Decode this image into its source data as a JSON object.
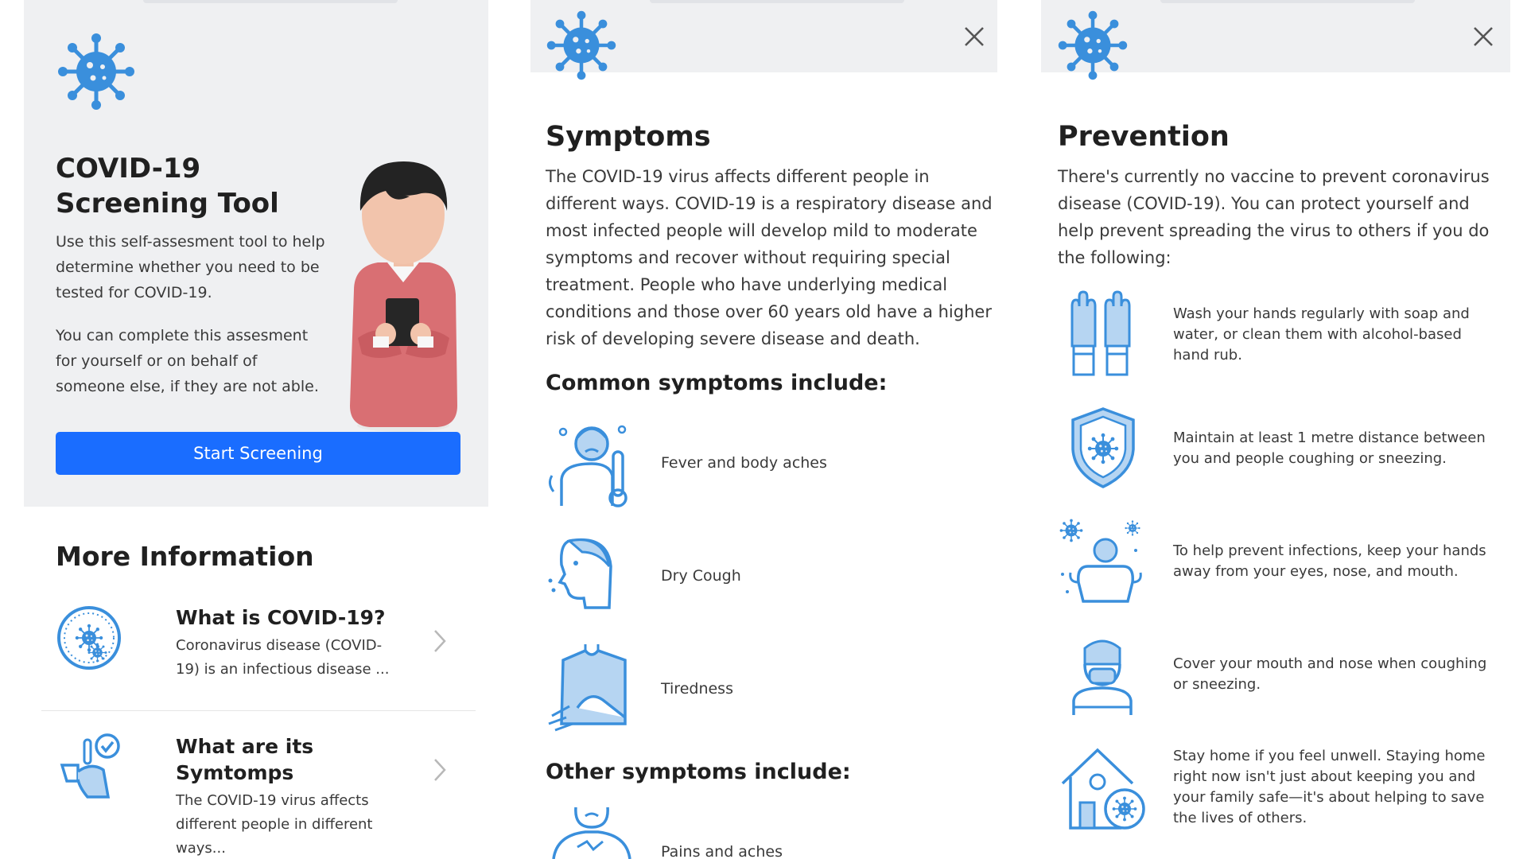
{
  "screening": {
    "title_line1": "COVID-19",
    "title_line2": "Screening Tool",
    "paragraph1": "Use this self-assesment tool to help determine whether you need to be tested for COVID-19.",
    "paragraph2": "You can complete this assesment for yourself or on behalf of someone else, if they are not able.",
    "button_label": "Start Screening"
  },
  "more_info": {
    "heading": "More Information",
    "items": [
      {
        "title": "What is COVID-19?",
        "desc": "Coronavirus disease (COVID-19) is an infectious disease ...",
        "icon": "virus-circle-icon"
      },
      {
        "title": "What are its Symtomps",
        "desc": "The COVID-19 virus affects different people in different ways...",
        "icon": "symptoms-check-icon"
      }
    ]
  },
  "symptoms": {
    "heading": "Symptoms",
    "intro": "The COVID-19 virus affects different people in different ways. COVID-19 is a respiratory disease and most infected people will develop mild to moderate symptoms and recover without requiring special treatment. People who have underlying medical conditions and those over 60 years old have a higher risk of developing severe disease and death.",
    "common_heading": "Common symptoms include:",
    "common": [
      {
        "label": "Fever and body aches",
        "icon": "fever-thermometer-icon"
      },
      {
        "label": "Dry Cough",
        "icon": "cough-face-icon"
      },
      {
        "label": "Tiredness",
        "icon": "tiredness-icon"
      }
    ],
    "other_heading": "Other symptoms include:",
    "other": [
      {
        "label": "Pains and aches",
        "icon": "pain-icon"
      }
    ]
  },
  "prevention": {
    "heading": "Prevention",
    "intro": "There's currently no vaccine to prevent coronavirus disease (COVID-19). You can protect yourself and help prevent spreading the virus to others if you do the following:",
    "items": [
      {
        "label": "Wash your hands regularly with soap and water, or clean them with alcohol-based hand rub.",
        "icon": "gloves-icon"
      },
      {
        "label": "Maintain at least 1 metre distance between you and people coughing or sneezing.",
        "icon": "shield-virus-icon"
      },
      {
        "label": "To help prevent infections, keep your hands away from your eyes, nose, and mouth.",
        "icon": "strong-person-icon"
      },
      {
        "label": "Cover your mouth and nose when coughing or sneezing.",
        "icon": "mask-person-icon"
      },
      {
        "label": "Stay home if you feel unwell. Staying home right now isn't just about keeping you and your family safe—it's about helping to save the lives of others.",
        "icon": "home-virus-icon"
      }
    ]
  },
  "colors": {
    "accent": "#1a6dff",
    "icon_blue": "#3a8fdc",
    "panel_bg": "#eff0f2"
  }
}
